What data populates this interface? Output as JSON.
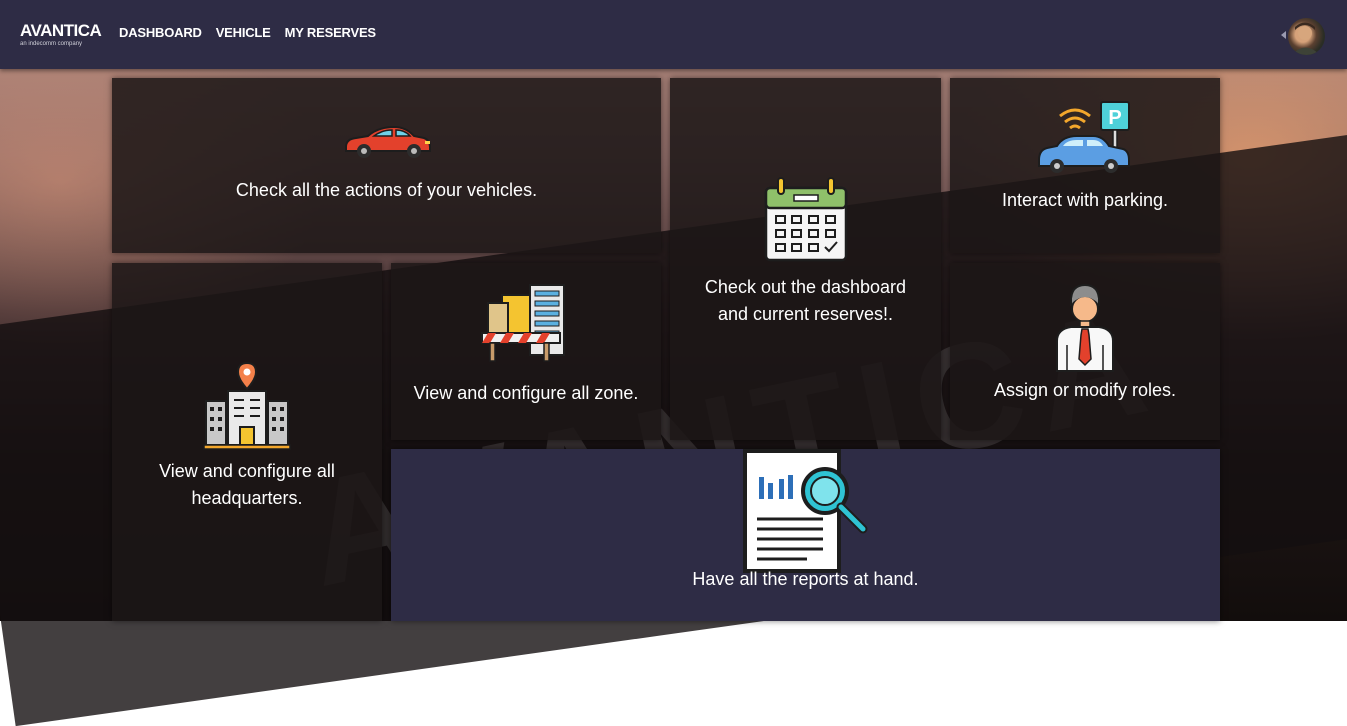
{
  "brand": {
    "name": "AVANTICA",
    "tagline": "an indecomm company"
  },
  "nav": {
    "items": [
      "DASHBOARD",
      "VEHICLE",
      "MY RESERVES"
    ]
  },
  "background": {
    "watermark": "AVANTICA"
  },
  "cards": {
    "vehicles": {
      "text": "Check all the actions of your vehicles.",
      "icon": "car-icon"
    },
    "dashboard": {
      "text": "Check out the dashboard and current reserves!.",
      "icon": "calendar-icon"
    },
    "parking": {
      "text": "Interact with parking.",
      "icon": "parking-car-icon"
    },
    "headquarters": {
      "text": "View and configure all headquarters.",
      "icon": "building-pin-icon"
    },
    "zone": {
      "text": "View and configure all zone.",
      "icon": "zone-buildings-icon"
    },
    "roles": {
      "text": "Assign or modify roles.",
      "icon": "businessman-icon"
    },
    "reports": {
      "text": "Have all the reports at hand.",
      "icon": "report-magnifier-icon"
    }
  },
  "colors": {
    "navbar": "#2e2c45",
    "card": "#1c1616",
    "accent": "#00b4c4"
  }
}
